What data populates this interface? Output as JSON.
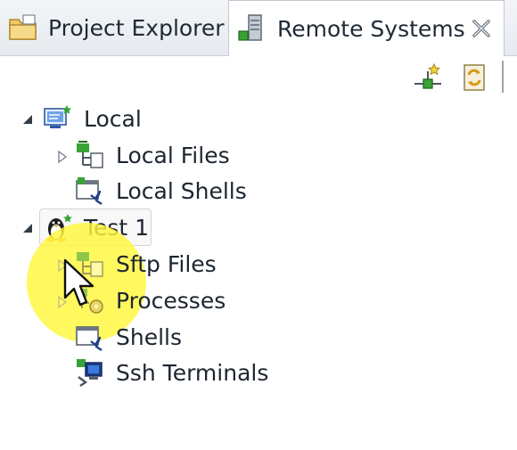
{
  "tabs": [
    {
      "label": "Project Explorer",
      "icon": "folder-icon",
      "active": false
    },
    {
      "label": "Remote Systems",
      "icon": "server-icon",
      "active": true
    }
  ],
  "toolbar": {
    "icons": [
      "new-connection-icon",
      "refresh-icon"
    ]
  },
  "tree": {
    "local": {
      "label": "Local",
      "children": [
        {
          "label": "Local Files",
          "icon": "files-subsystem-icon"
        },
        {
          "label": "Local Shells",
          "icon": "shell-icon"
        }
      ]
    },
    "test": {
      "label": "Test 1",
      "children": [
        {
          "label": "Sftp Files",
          "icon": "files-subsystem-icon"
        },
        {
          "label": "Processes",
          "icon": "processes-icon"
        },
        {
          "label": "Shells",
          "icon": "shell-icon"
        },
        {
          "label": "Ssh Terminals",
          "icon": "terminal-icon"
        }
      ]
    }
  },
  "colors": {
    "accent_green": "#3aa236",
    "highlight": "#fff63c"
  }
}
